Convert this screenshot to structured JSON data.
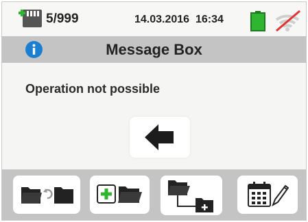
{
  "status_bar": {
    "memory_icon": "memory-card-icon",
    "memory_count": "5/999",
    "datetime": "14.03.2016  16:34",
    "battery_icon": "battery-icon",
    "wifi_icon": "wifi-off-icon",
    "battery_color": "#2fb52f",
    "wifi_off_color": "#e3322f"
  },
  "title_bar": {
    "info_icon": "info-icon",
    "title": "Message Box",
    "info_color": "#1a7fd0"
  },
  "message": {
    "text": "Operation not possible"
  },
  "back_button": {
    "icon": "arrow-left-icon"
  },
  "toolbar": {
    "buttons": [
      {
        "icon": "rename-folder-icon"
      },
      {
        "icon": "add-folder-icon"
      },
      {
        "icon": "add-subfolder-icon"
      },
      {
        "icon": "calendar-edit-icon"
      }
    ],
    "accent_green": "#2fb52f"
  }
}
